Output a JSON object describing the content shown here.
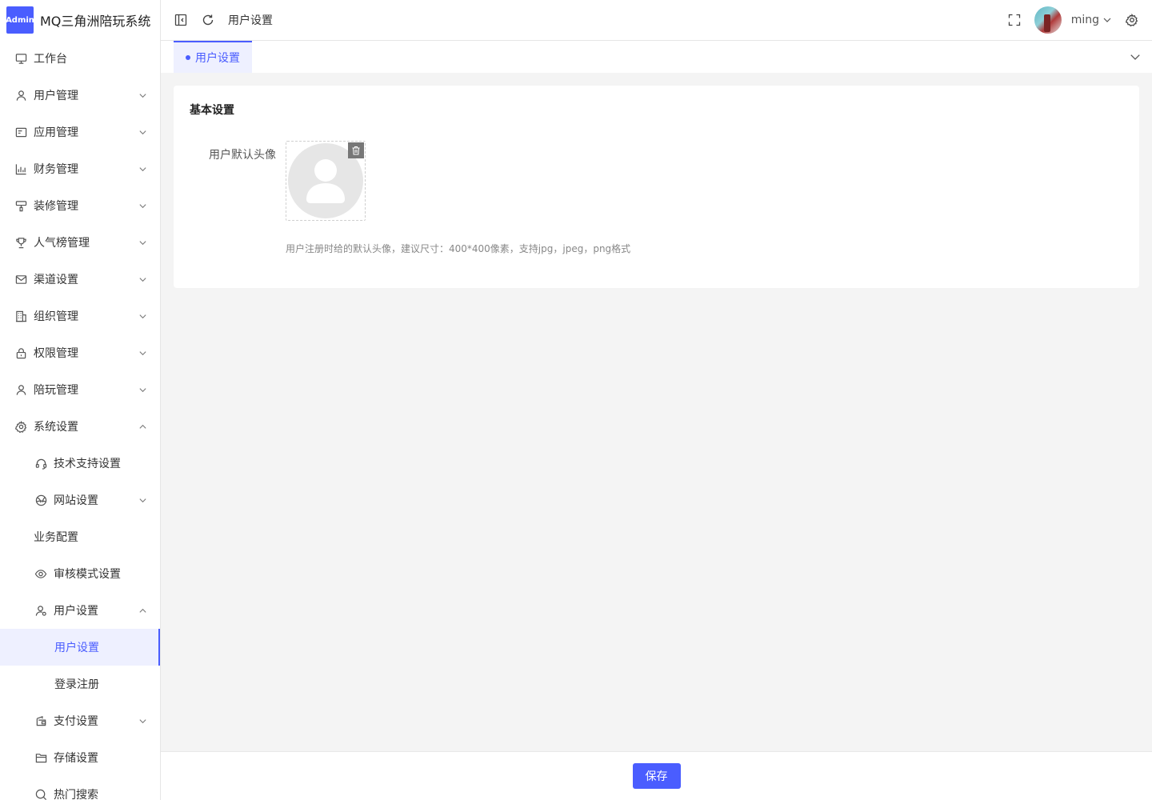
{
  "brand": {
    "logo_text": "Admin",
    "title": "MQ三角洲陪玩系统"
  },
  "sidebar": {
    "items": [
      {
        "label": "工作台",
        "icon": "monitor-icon"
      },
      {
        "label": "用户管理",
        "icon": "user-icon",
        "expanded": false
      },
      {
        "label": "应用管理",
        "icon": "app-card-icon",
        "expanded": false
      },
      {
        "label": "财务管理",
        "icon": "bar-chart-icon",
        "expanded": false
      },
      {
        "label": "装修管理",
        "icon": "paint-roller-icon",
        "expanded": false
      },
      {
        "label": "人气榜管理",
        "icon": "trophy-icon",
        "expanded": false
      },
      {
        "label": "渠道设置",
        "icon": "mail-icon",
        "expanded": false
      },
      {
        "label": "组织管理",
        "icon": "building-icon",
        "expanded": false
      },
      {
        "label": "权限管理",
        "icon": "lock-icon",
        "expanded": false
      },
      {
        "label": "陪玩管理",
        "icon": "user-icon",
        "expanded": false
      },
      {
        "label": "系统设置",
        "icon": "gear-icon",
        "expanded": true
      },
      {
        "label": "技术支持设置",
        "icon": "headset-icon"
      },
      {
        "label": "网站设置",
        "icon": "globe-icon",
        "expanded": false
      },
      {
        "label": "业务配置"
      },
      {
        "label": "审核模式设置",
        "icon": "eye-icon"
      },
      {
        "label": "用户设置",
        "icon": "user-group-icon",
        "expanded": true
      },
      {
        "label": "用户设置",
        "active": true
      },
      {
        "label": "登录注册"
      },
      {
        "label": "支付设置",
        "icon": "wallet-icon",
        "expanded": false
      },
      {
        "label": "存储设置",
        "icon": "folder-icon"
      },
      {
        "label": "热门搜索",
        "icon": "search-icon"
      }
    ]
  },
  "header": {
    "breadcrumb": "用户设置",
    "username": "ming",
    "icons": [
      "sidebar-collapse-icon",
      "refresh-icon",
      "fullscreen-icon",
      "gear-icon"
    ]
  },
  "tabs": [
    {
      "label": "用户设置",
      "active": true
    }
  ],
  "card": {
    "title": "基本设置",
    "avatar_label": "用户默认头像",
    "hint": "用户注册时给的默认头像，建议尺寸：400*400像素，支持jpg，jpeg，png格式"
  },
  "footer": {
    "save_label": "保存"
  },
  "colors": {
    "accent": "#4a5dff",
    "background": "#f4f4f4"
  }
}
